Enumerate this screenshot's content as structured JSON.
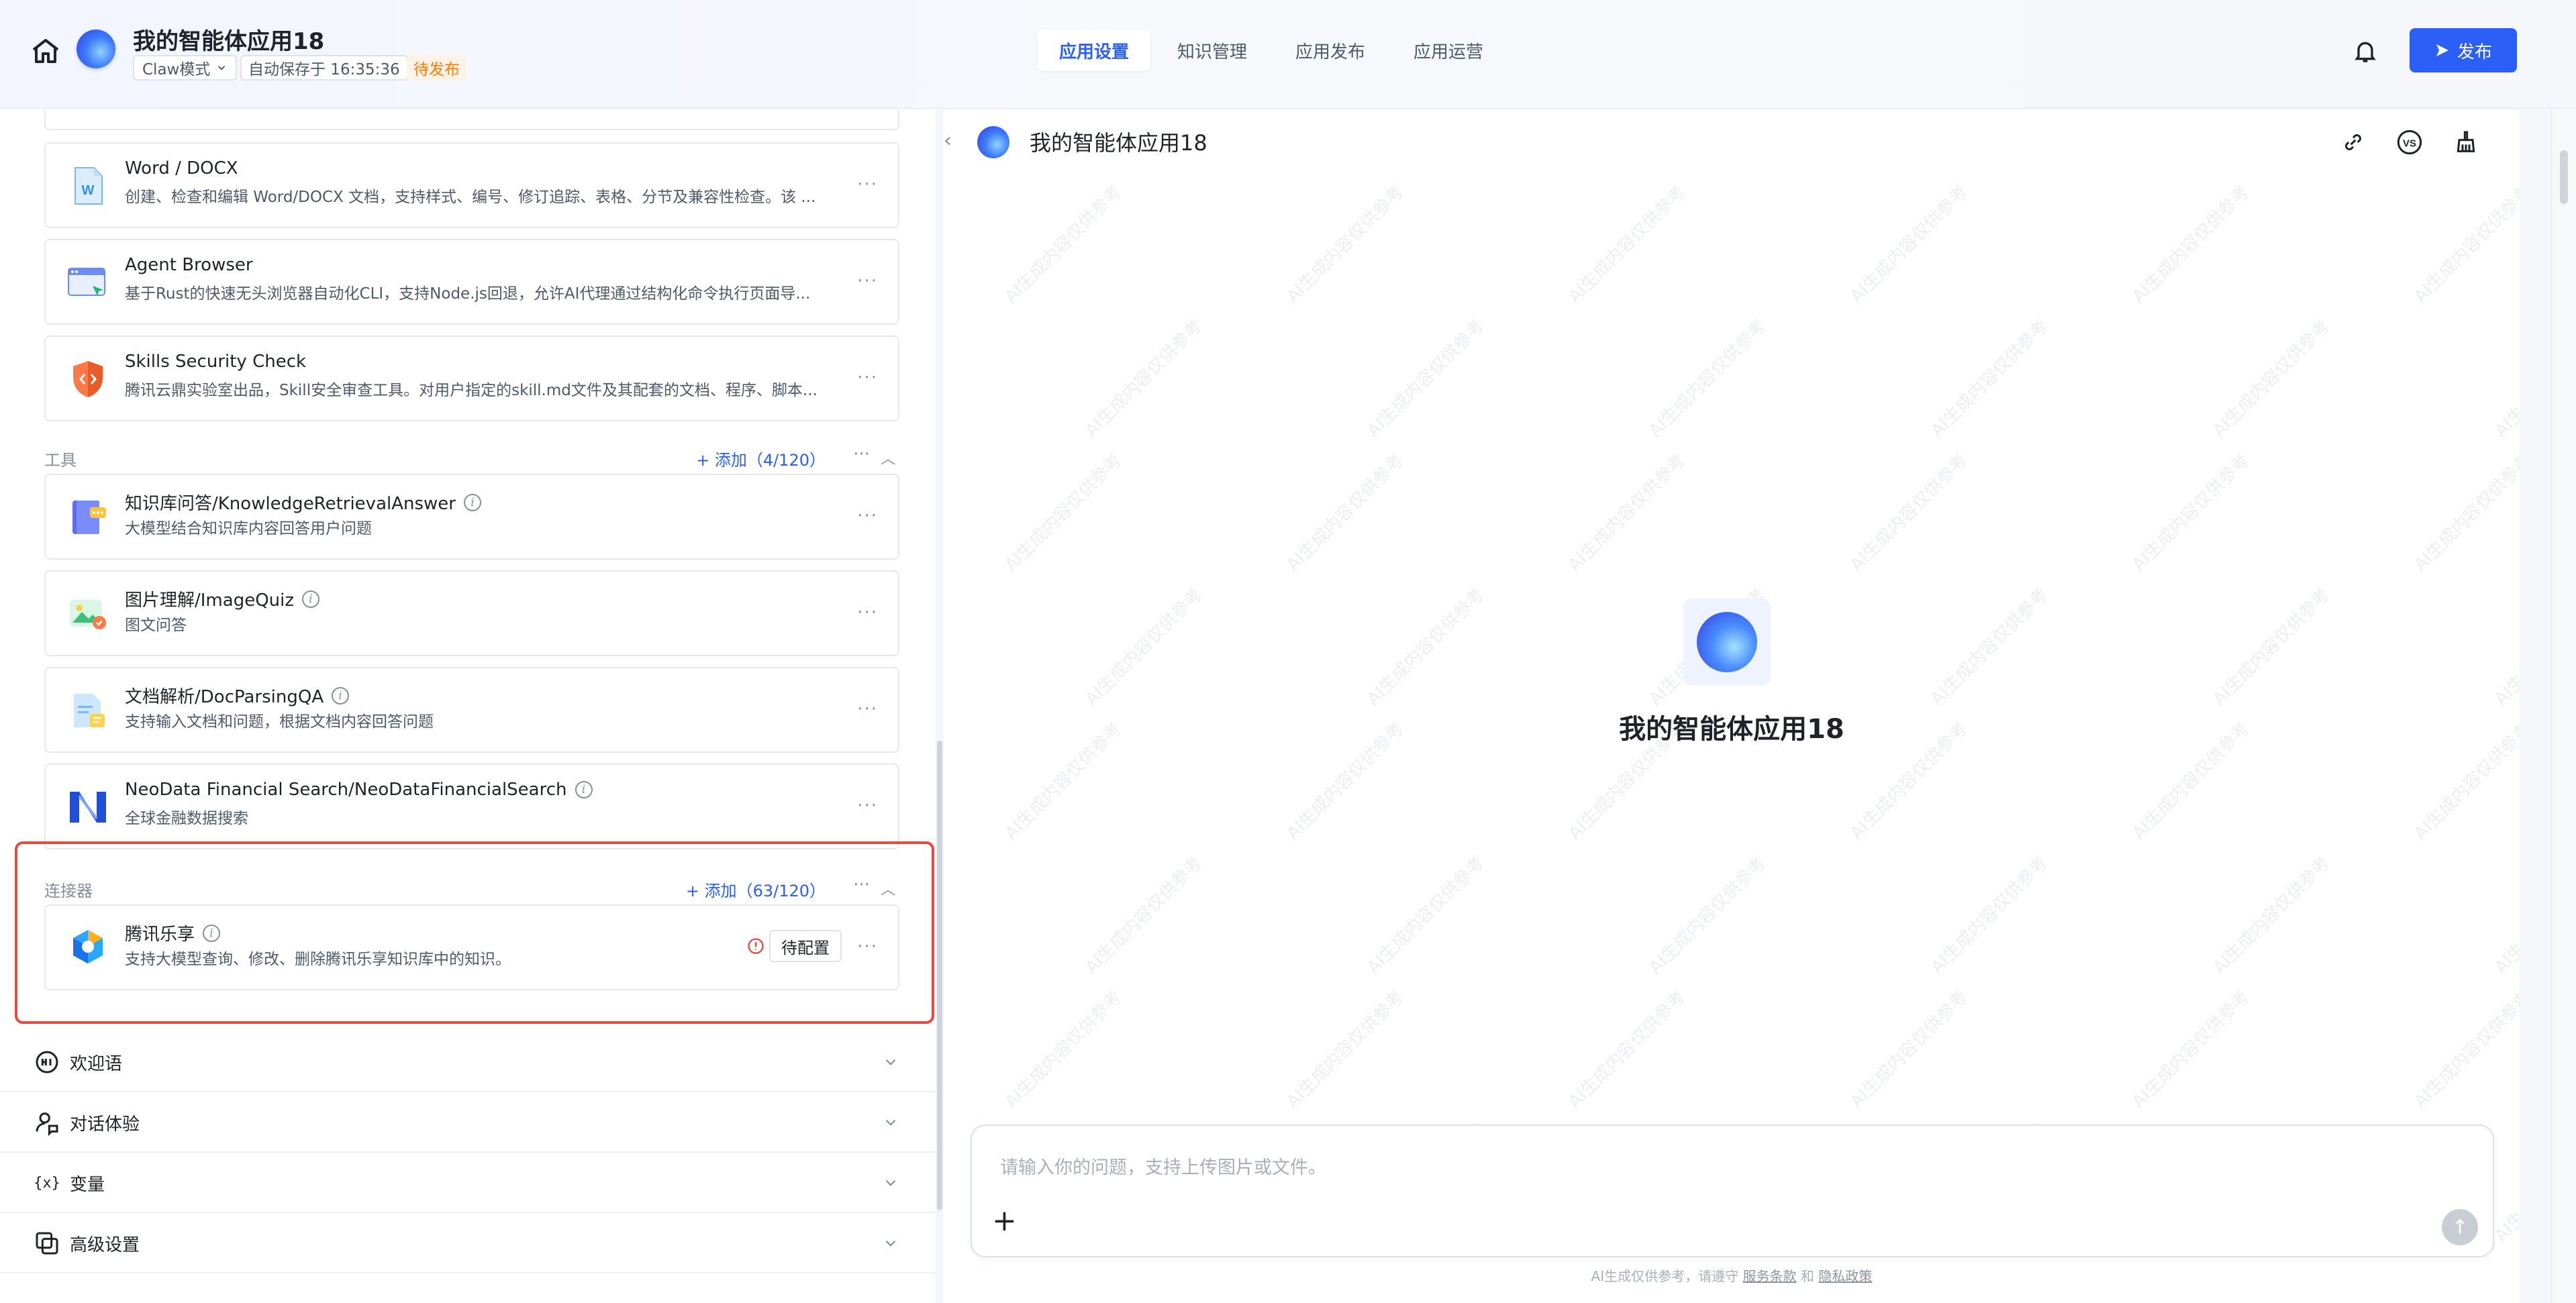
{
  "header": {
    "app_title": "我的智能体应用18",
    "mode": "Claw模式",
    "autosave": "自动保存于 16:35:36",
    "status": "待发布",
    "tabs": [
      {
        "label": "应用设置",
        "active": true
      },
      {
        "label": "知识管理",
        "active": false
      },
      {
        "label": "应用发布",
        "active": false
      },
      {
        "label": "应用运营",
        "active": false
      }
    ],
    "publish_label": "发布"
  },
  "skills": [
    {
      "title": "Word / DOCX",
      "desc": "创建、检查和编辑 Word/DOCX 文档，支持样式、编号、修订追踪、表格、分节及兼容性检查。该 ...",
      "icon": "word-doc-icon"
    },
    {
      "title": "Agent Browser",
      "desc": "基于Rust的快速无头浏览器自动化CLI，支持Node.js回退，允许AI代理通过结构化命令执行页面导...",
      "icon": "browser-icon"
    },
    {
      "title": "Skills Security Check",
      "desc": "腾讯云鼎实验室出品，Skill安全审查工具。对用户指定的skill.md文件及其配套的文档、程序、脚本...",
      "icon": "shield-code-icon"
    }
  ],
  "tools_section": {
    "label": "工具",
    "add_label": "+ 添加（4/120）",
    "items": [
      {
        "title": "知识库问答/KnowledgeRetrievalAnswer",
        "desc": "大模型结合知识库内容回答用户问题",
        "icon": "knowledge-book-icon"
      },
      {
        "title": "图片理解/ImageQuiz",
        "desc": "图文问答",
        "icon": "image-icon"
      },
      {
        "title": "文档解析/DocParsingQA",
        "desc": "支持输入文档和问题，根据文档内容回答问题",
        "icon": "doc-parse-icon"
      },
      {
        "title": "NeoData Financial Search/NeoDataFinancialSearch",
        "desc": "全球金融数据搜索",
        "icon": "neodata-logo-icon"
      }
    ]
  },
  "connectors_section": {
    "label": "连接器",
    "add_label": "+ 添加（63/120）",
    "items": [
      {
        "title": "腾讯乐享",
        "desc": "支持大模型查询、修改、删除腾讯乐享知识库中的知识。",
        "status_label": "待配置",
        "icon": "lexiang-logo-icon"
      }
    ]
  },
  "collapsibles": [
    {
      "label": "欢迎语",
      "icon": "hi-icon"
    },
    {
      "label": "对话体验",
      "icon": "user-chat-icon"
    },
    {
      "label": "变量",
      "icon": "variable-icon"
    },
    {
      "label": "高级设置",
      "icon": "settings-copy-icon"
    }
  ],
  "preview": {
    "title": "我的智能体应用18",
    "center_title": "我的智能体应用18",
    "input_placeholder": "请输入你的问题，支持上传图片或文件。",
    "disclaimer_prefix": "AI生成仅供参考，请遵守",
    "disclaimer_link1": "服务条款",
    "disclaimer_mid": "和",
    "disclaimer_link2": "隐私政策",
    "watermark_text": "AI生成内容仅供参考"
  },
  "colors": {
    "accent": "#2c5ff6",
    "warning": "#ff7d00",
    "highlight": "#e84a3f"
  }
}
